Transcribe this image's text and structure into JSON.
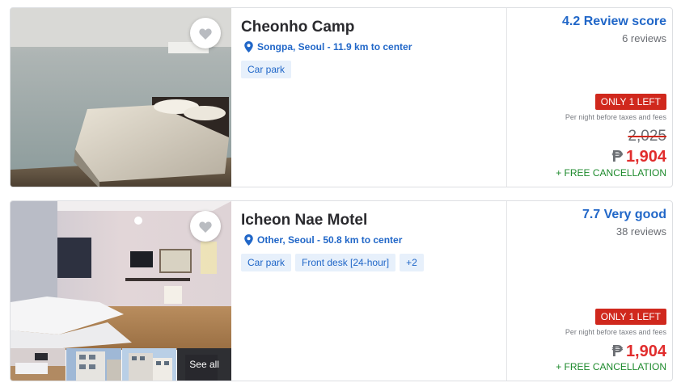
{
  "hotels": [
    {
      "name": "Cheonho Camp",
      "location": "Songpa, Seoul - 11.9 km to center",
      "amenities": [
        "Car park"
      ],
      "score_text": "4.2 Review score",
      "reviews": "6 reviews",
      "availability": "ONLY 1 LEFT",
      "price_note": "Per night before taxes and fees",
      "original_price": "2,025",
      "currency": "₱",
      "price": "1,904",
      "cancellation": "+ FREE CANCELLATION"
    },
    {
      "name": "Icheon Nae Motel",
      "location": "Other, Seoul - 50.8 km to center",
      "amenities": [
        "Car park",
        "Front desk [24-hour]",
        "+2"
      ],
      "score_text": "7.7 Very good",
      "reviews": "38 reviews",
      "availability": "ONLY 1 LEFT",
      "price_note": "Per night before taxes and fees",
      "currency": "₱",
      "price": "1,904",
      "cancellation": "+ FREE CANCELLATION",
      "see_all": "See all"
    }
  ],
  "colors": {
    "link_blue": "#2167c8",
    "chip_bg": "#e7f0fb",
    "price_red": "#e12d2d",
    "badge_red": "#d0281d",
    "cancel_green": "#1d8a2c"
  },
  "icons": {
    "favorite": "heart-icon",
    "location": "map-pin-icon"
  }
}
